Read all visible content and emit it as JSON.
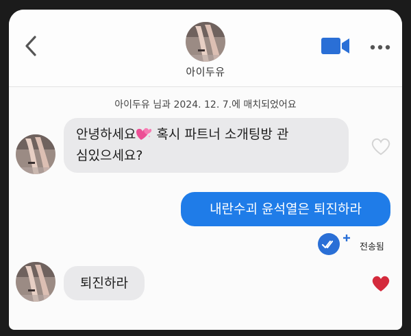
{
  "header": {
    "name": "아이두유",
    "back_icon": "chevron-left-icon",
    "video_icon": "video-camera-icon",
    "more_icon": "more-horizontal-icon",
    "accent": "#2a6fd6"
  },
  "chat": {
    "match_notice": "아이두유 님과 2024. 12. 7.에 매치되었어요",
    "messages": [
      {
        "direction": "incoming",
        "line1_before": "안녕하세요",
        "line1_emoji": "sparkling-hearts-emoji",
        "line1_after": " 혹시 파트너 소개팅방 관",
        "line2": "심있으세요?",
        "liked": false
      },
      {
        "direction": "outgoing",
        "text": "내란수괴 윤석열은 퇴진하라",
        "status": "전송됨",
        "status_icon": "double-check-icon"
      },
      {
        "direction": "incoming",
        "text": "퇴진하라",
        "liked": true
      }
    ]
  },
  "colors": {
    "outgoing_bubble": "#1f7ce8",
    "incoming_bubble": "#e9e9eb",
    "liked_heart": "#d42a3c"
  }
}
